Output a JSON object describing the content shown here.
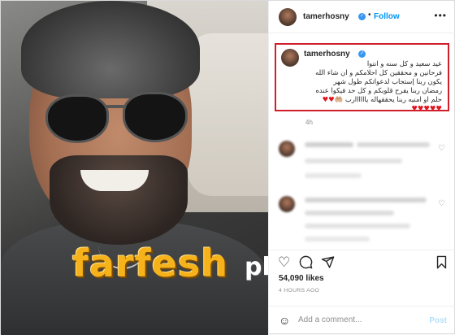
{
  "header": {
    "username": "tamerhosny",
    "follow_label": "Follow",
    "dot": "•",
    "more_label": "•••"
  },
  "caption": {
    "username": "tamerhosny",
    "lines": [
      "عيد سعيد و كل سنه و انتوا",
      "فرحانين و محققين كل احلامكم و ان شاء الله",
      "يكون ربنا إستجاب لدعواتكم طول شهر",
      "رمضان ربنا يفرح قلوبكم و كل حد فيكوا عنده",
      "حلم او امنيه ربنا يحققهاله ياااااارب"
    ],
    "emoji_line1": "🤲🏼♥♥",
    "emoji_line2": "♥♥♥♥♥",
    "time": "4h"
  },
  "comments": [
    {
      "meta": ""
    },
    {
      "meta": ""
    }
  ],
  "actions": {
    "like_icon": "heart-outline-icon",
    "comment_icon": "comment-icon",
    "share_icon": "share-icon",
    "save_icon": "bookmark-icon"
  },
  "likes": "54,090 likes",
  "post_time": "4 HOURS AGO",
  "add_comment": {
    "placeholder": "Add a comment...",
    "post_label": "Post"
  },
  "watermark": {
    "brand": "farfesh",
    "suffix": "plus.com"
  },
  "colors": {
    "highlight_border": "#d01f2a",
    "link_blue": "#0095f6",
    "heart_red": "#e0151f"
  }
}
